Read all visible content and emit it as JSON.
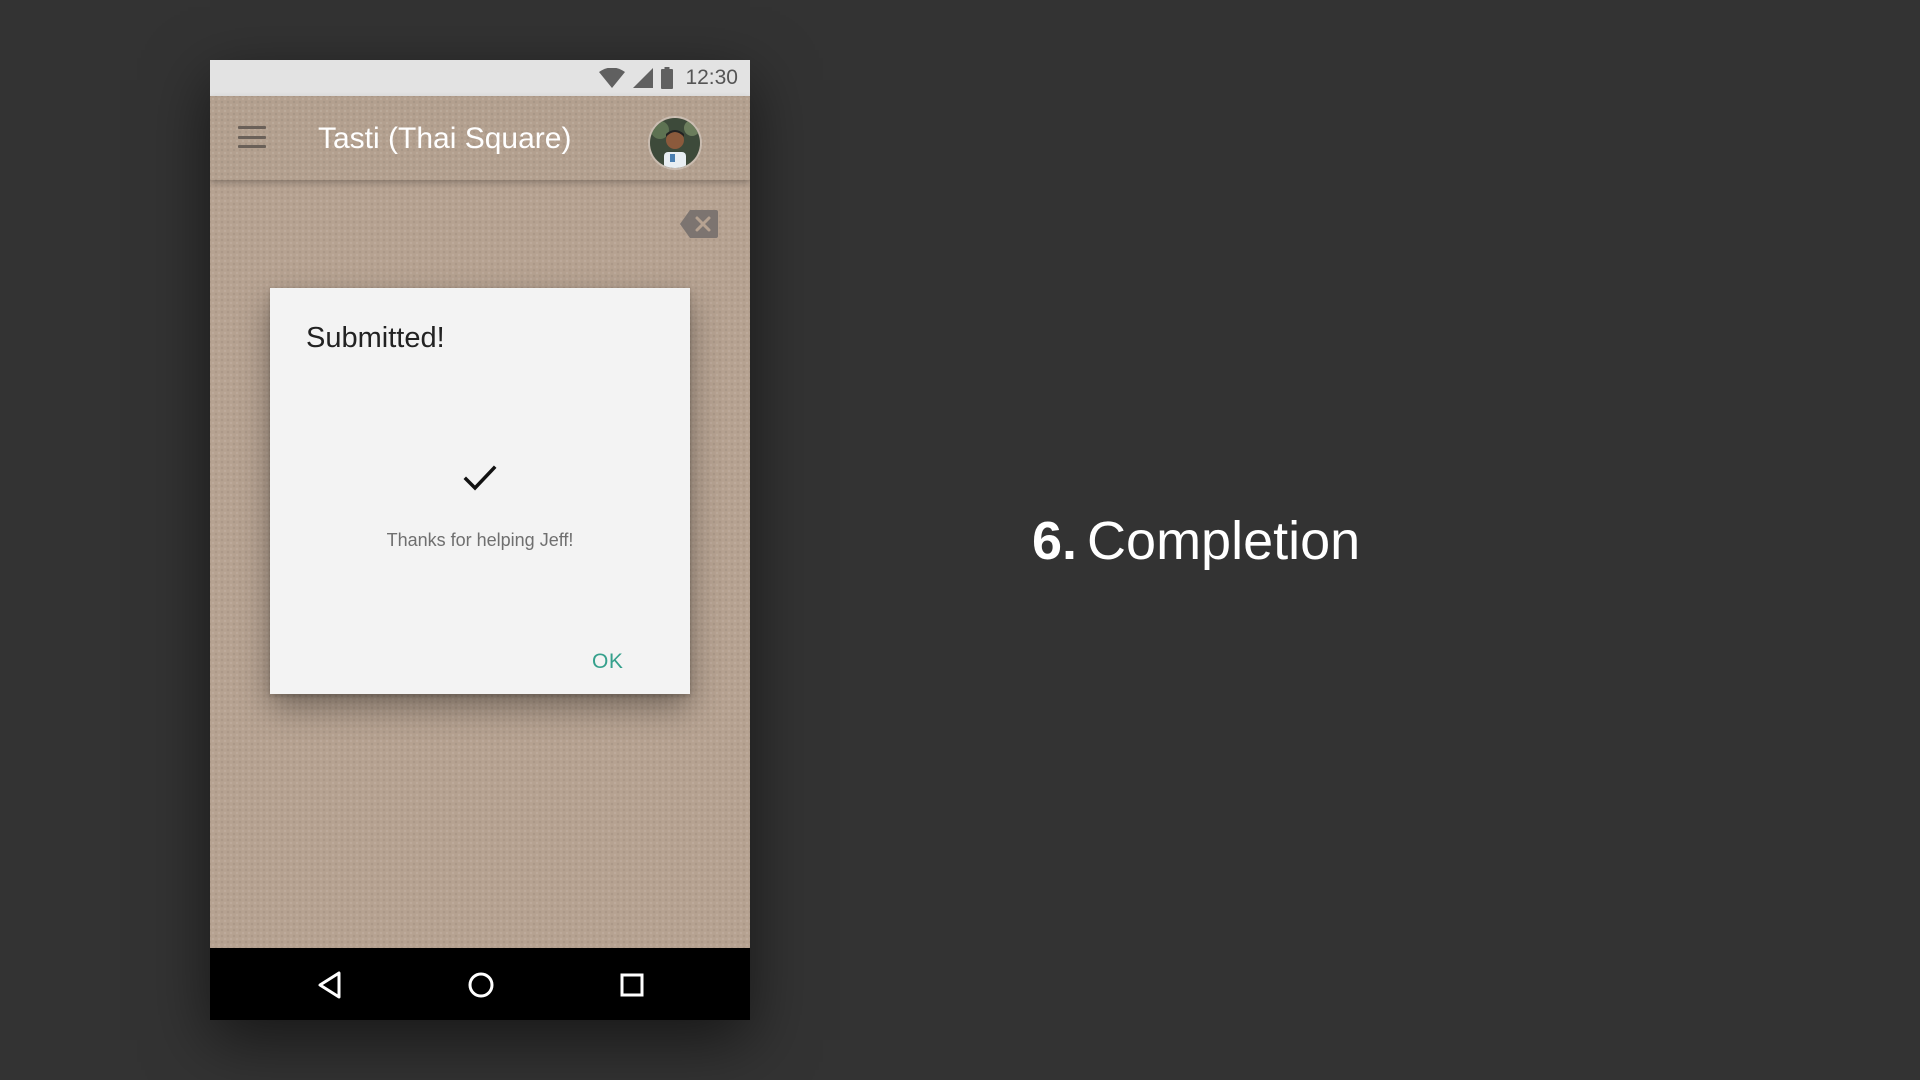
{
  "status_bar": {
    "time": "12:30",
    "icons": [
      "wifi-icon",
      "cell-signal-icon",
      "battery-icon"
    ]
  },
  "app_bar": {
    "title": "Tasti (Thai Square)",
    "menu_icon": "hamburger-menu-icon",
    "avatar_icon": "user-avatar"
  },
  "content": {
    "clear_icon": "backspace-icon"
  },
  "dialog": {
    "title": "Submitted!",
    "icon": "checkmark-icon",
    "message": "Thanks for helping Jeff!",
    "ok_label": "OK"
  },
  "nav_bar": {
    "back_icon": "back-triangle-icon",
    "home_icon": "home-circle-icon",
    "recents_icon": "recents-square-icon"
  },
  "caption": {
    "number": "6.",
    "text": "Completion"
  },
  "colors": {
    "background": "#333333",
    "app_surface": "#b6a291",
    "dialog_bg": "#f3f3f3",
    "accent": "#35a08c",
    "status_bar": "#e3e3e3"
  }
}
